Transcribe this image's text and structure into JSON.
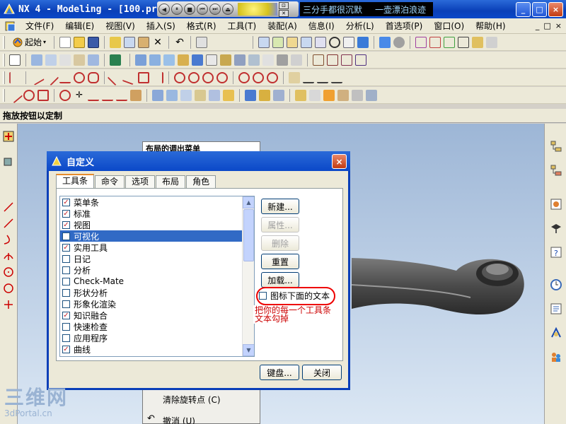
{
  "window": {
    "title": "NX 4 - Modeling - [100.pr",
    "marquee": [
      "三分手都很沉默",
      "一壶漂泊浪迹"
    ],
    "controls": [
      "_",
      "□",
      "×"
    ]
  },
  "player": {
    "buttons": [
      "◀",
      "⏸",
      "■",
      "⏮",
      "⏭",
      "⏏"
    ],
    "mini_buttons": [
      "⊡",
      "✕"
    ]
  },
  "menubar": {
    "items": [
      "文件(F)",
      "编辑(E)",
      "视图(V)",
      "插入(S)",
      "格式(R)",
      "工具(T)",
      "装配(A)",
      "信息(I)",
      "分析(L)",
      "首选项(P)",
      "窗口(O)",
      "帮助(H)"
    ],
    "mdi_controls": [
      "_",
      "□",
      "×"
    ]
  },
  "toolbar": {
    "start_label": "起始"
  },
  "status": {
    "hint": "拖放按钮以定制"
  },
  "popup": {
    "header": "布局的调出菜单",
    "items": [
      "清除旋转点 (C)",
      "撤消 (U)"
    ]
  },
  "dialog": {
    "title": "自定义",
    "close": "×",
    "tabs": [
      "工具条",
      "命令",
      "选项",
      "布局",
      "角色"
    ],
    "active_tab": 0,
    "toolbars": [
      {
        "label": "菜单条",
        "checked": true
      },
      {
        "label": "标准",
        "checked": true
      },
      {
        "label": "视图",
        "checked": true
      },
      {
        "label": "可视化",
        "checked": false,
        "selected": true
      },
      {
        "label": "实用工具",
        "checked": true
      },
      {
        "label": "日记",
        "checked": false
      },
      {
        "label": "分析",
        "checked": false
      },
      {
        "label": "Check-Mate",
        "checked": false
      },
      {
        "label": "形状分析",
        "checked": false
      },
      {
        "label": "形象化渲染",
        "checked": false
      },
      {
        "label": "知识融合",
        "checked": true
      },
      {
        "label": "快速检查",
        "checked": false
      },
      {
        "label": "应用程序",
        "checked": false
      },
      {
        "label": "曲线",
        "checked": true
      }
    ],
    "buttons": {
      "new": "新建...",
      "properties": "属性...",
      "delete": "删除",
      "reset": "重置",
      "load": "加载...",
      "keyboard": "键盘...",
      "close": "关闭"
    },
    "icon_text_option": {
      "label": "图标下面的文本",
      "checked": false
    },
    "annotation": "把你的每一个工具条文本勾掉"
  },
  "watermark": {
    "brand": "三维网",
    "site": "3dPortal.cn"
  }
}
